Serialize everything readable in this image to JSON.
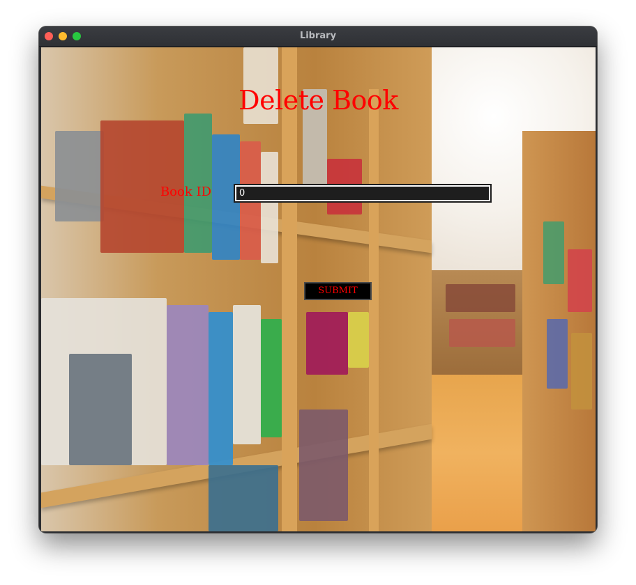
{
  "window": {
    "title": "Library"
  },
  "form": {
    "heading": "Delete Book",
    "book_id_label": "Book ID",
    "book_id_value": "0",
    "submit_label": "SUBMIT"
  },
  "colors": {
    "text_accent": "#ff0000",
    "input_bg": "#1e1e1e",
    "button_bg": "#000000"
  },
  "icons": {
    "close": "close-dot-icon",
    "minimize": "minimize-dot-icon",
    "maximize": "maximize-dot-icon"
  }
}
